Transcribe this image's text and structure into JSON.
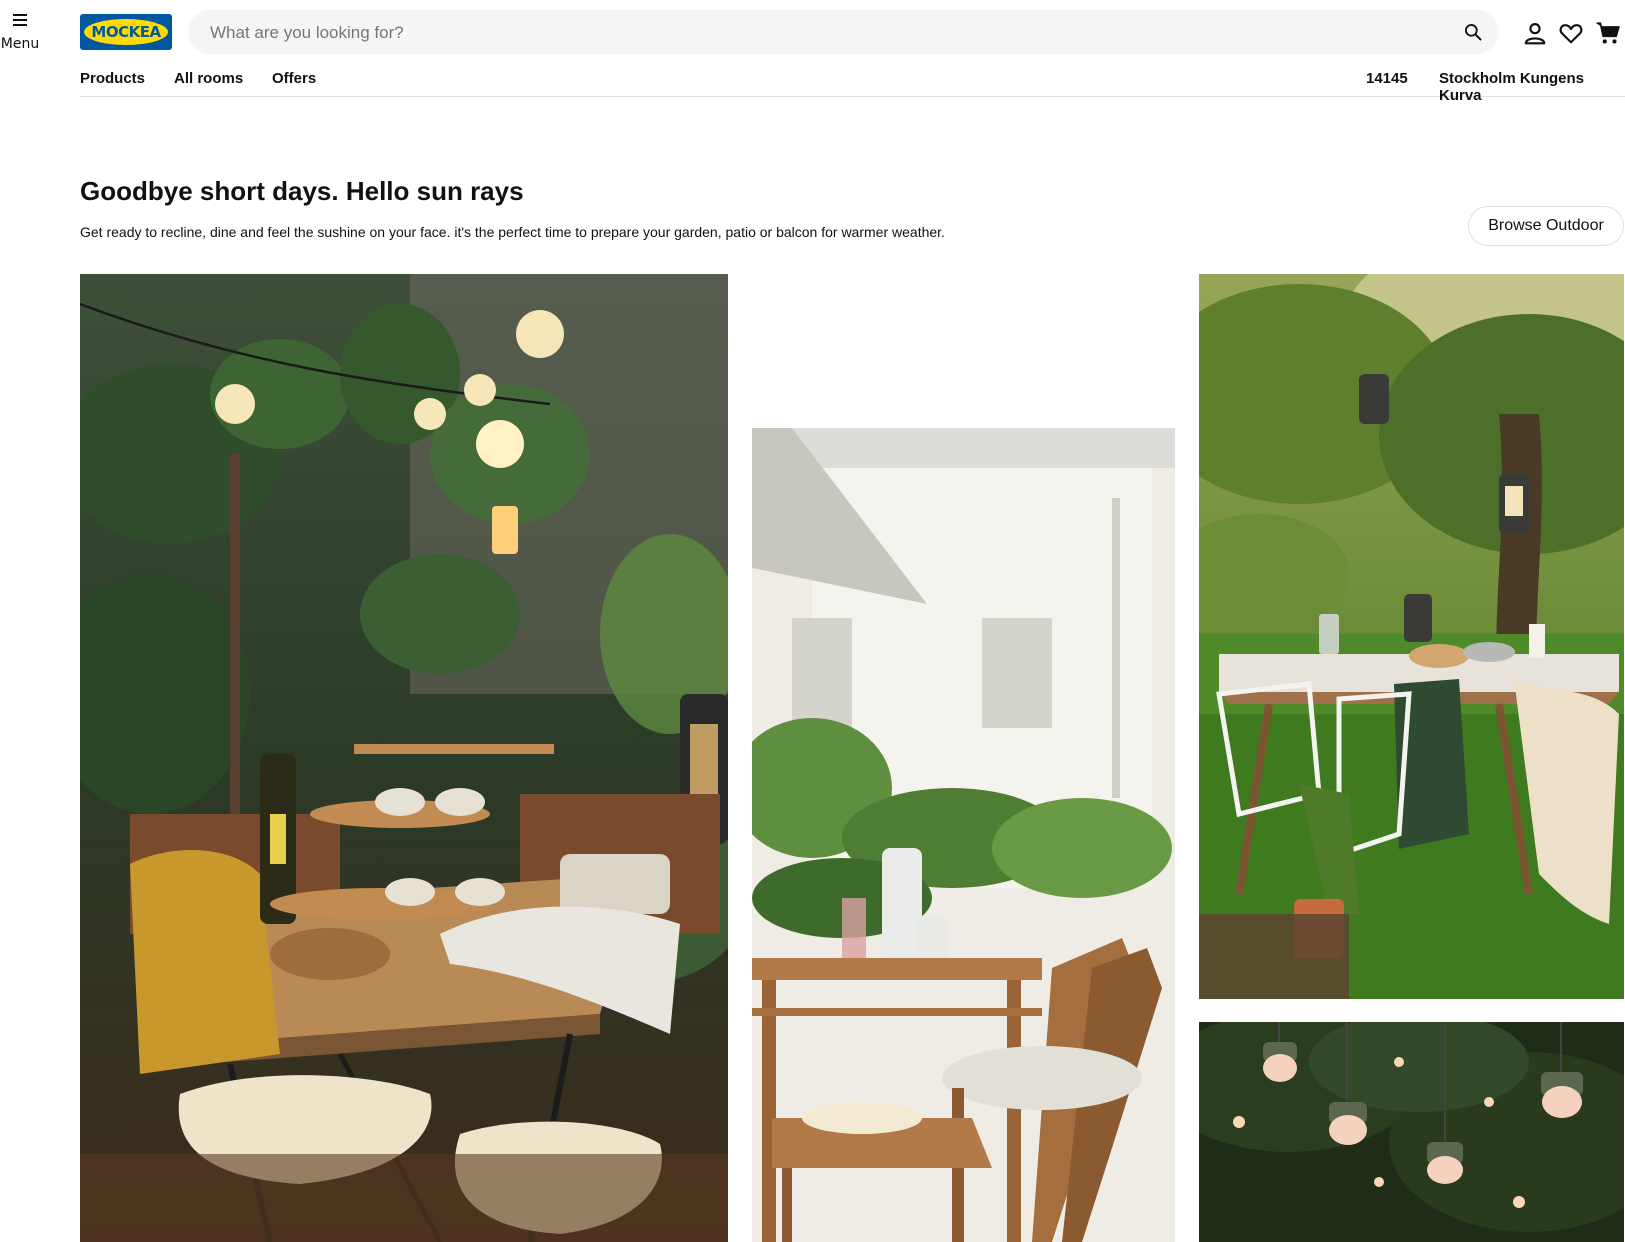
{
  "header": {
    "menu_label": "Menu",
    "logo_text": "MOCKEA",
    "logo_mark": "®",
    "search_placeholder": "What are you looking for?",
    "icons": [
      "hamburger-icon",
      "search-icon",
      "user-icon",
      "heart-icon",
      "cart-icon"
    ]
  },
  "nav": {
    "items": [
      "Products",
      "All rooms",
      "Offers"
    ],
    "postal_code": "14145",
    "store": "Stockholm Kungens Kurva"
  },
  "hero": {
    "title": "Goodbye short days. Hello sun rays",
    "description": "Get ready to recline, dine and feel the sushine on your face. it's the perfect time to prepare your garden, patio or balcon for warmer weather.",
    "cta_label": "Browse Outdoor"
  },
  "colors": {
    "logo_blue": "#0058a3",
    "logo_yellow": "#ffdb00",
    "search_bg": "#f5f5f5",
    "divider": "#dfdfdf"
  }
}
